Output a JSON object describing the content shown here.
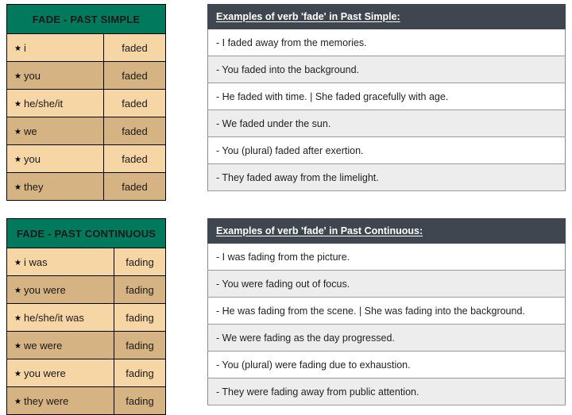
{
  "verb": "fade",
  "colors": {
    "conjugation_header_bg": "#00795C",
    "conjugation_row_light": "#F7D6A6",
    "conjugation_row_dark": "#D6B383",
    "examples_header_bg": "#3F464F",
    "examples_row_light": "#FFFFFF",
    "examples_row_alt": "#EDEDED",
    "border": "#000000"
  },
  "star_glyph": "★",
  "sections": [
    {
      "id": "past-simple",
      "conjugation": {
        "header": "FADE - PAST SIMPLE",
        "rows": [
          {
            "pronoun": "i",
            "form": "faded"
          },
          {
            "pronoun": "you",
            "form": "faded"
          },
          {
            "pronoun": "he/she/it",
            "form": "faded"
          },
          {
            "pronoun": "we",
            "form": "faded"
          },
          {
            "pronoun": "you",
            "form": "faded"
          },
          {
            "pronoun": "they",
            "form": "faded"
          }
        ]
      },
      "examples": {
        "header": "Examples of verb 'fade' in Past Simple:",
        "rows": [
          "- I faded away from the memories.",
          "- You faded into the background.",
          "- He faded with time. | She faded gracefully with age.",
          "- We faded under the sun.",
          "- You (plural) faded after exertion.",
          "- They faded away from the limelight."
        ]
      }
    },
    {
      "id": "past-continuous",
      "conjugation": {
        "header": "FADE - PAST CONTINUOUS",
        "rows": [
          {
            "pronoun": "i was",
            "form": "fading"
          },
          {
            "pronoun": "you were",
            "form": "fading"
          },
          {
            "pronoun": "he/she/it was",
            "form": "fading"
          },
          {
            "pronoun": "we were",
            "form": "fading"
          },
          {
            "pronoun": "you were",
            "form": "fading"
          },
          {
            "pronoun": "they were",
            "form": "fading"
          }
        ]
      },
      "examples": {
        "header": "Examples of verb 'fade' in Past Continuous:",
        "rows": [
          "- I was fading from the picture.",
          "- You were fading out of focus.",
          "- He was fading from the scene. | She was fading into the background.",
          "- We were fading as the day progressed.",
          "- You (plural) were fading due to exhaustion.",
          "- They were fading away from public attention."
        ]
      }
    }
  ]
}
